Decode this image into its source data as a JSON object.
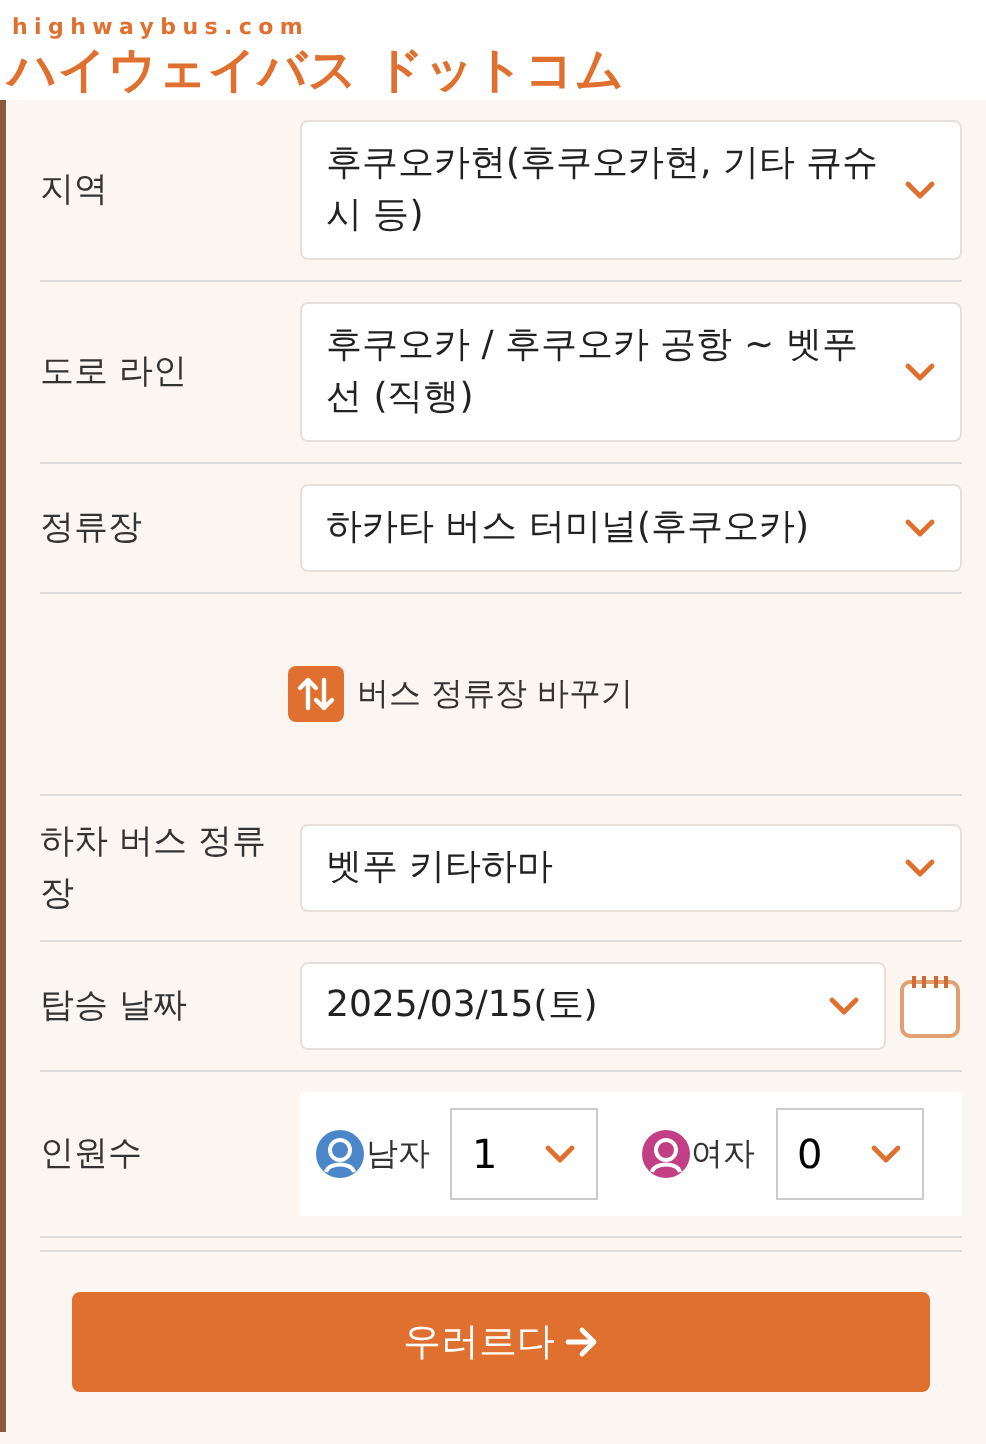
{
  "header": {
    "domain": "highwaybus.com",
    "title": "ハイウェイバス ドットコム"
  },
  "rows": [
    {
      "kind": "select",
      "label": "지역",
      "value": "후쿠오카현(후쿠오카현, 기타 큐슈시 등)"
    },
    {
      "kind": "select",
      "label": "도로 라인",
      "value": "후쿠오카 / 후쿠오카 공항 ~ 벳푸 선 (직행)"
    },
    {
      "kind": "select",
      "label": "정류장",
      "value": "하카타 버스 터미널(후쿠오카)"
    },
    {
      "kind": "swap",
      "value": "버스 정류장 바꾸기"
    },
    {
      "kind": "select",
      "label": "하차 버스 정류장",
      "value": "벳푸 키타하마"
    },
    {
      "kind": "date",
      "label": "탑승 날짜",
      "value": "2025/03/15(토)"
    },
    {
      "kind": "people",
      "label": "인원수",
      "groups": [
        {
          "label": "남자",
          "value": "1",
          "color": "#4a86c8"
        },
        {
          "label": "여자",
          "value": "0",
          "color": "#c23f85"
        }
      ]
    }
  ],
  "submit": {
    "label": "우러르다"
  }
}
